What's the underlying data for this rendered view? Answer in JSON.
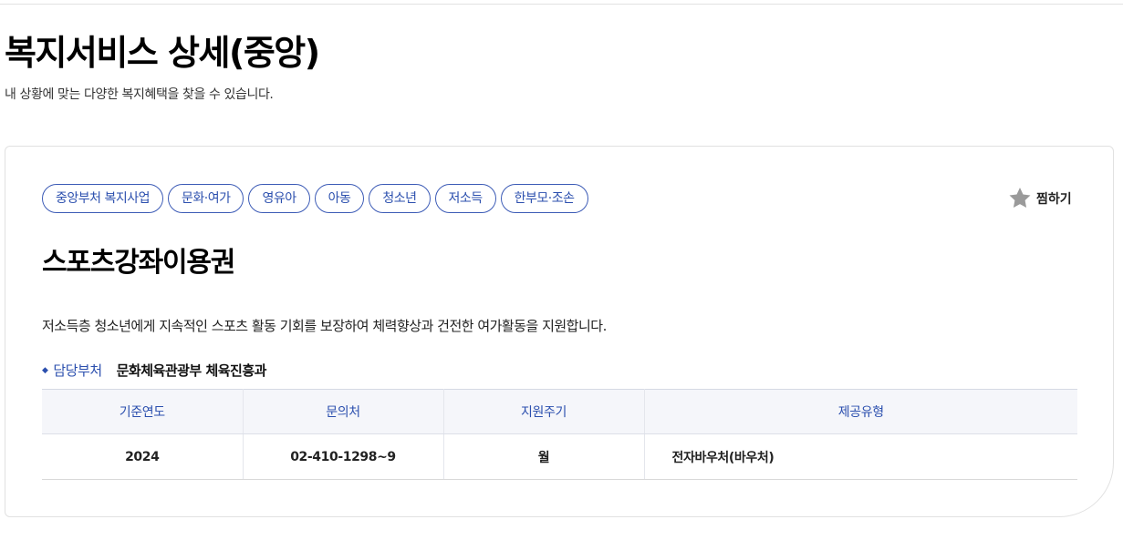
{
  "page": {
    "title": "복지서비스 상세(중앙)",
    "subtitle": "내 상황에 맞는 다양한 복지혜택을 찾을 수 있습니다."
  },
  "card": {
    "tags": [
      "중앙부처 복지사업",
      "문화·여가",
      "영유아",
      "아동",
      "청소년",
      "저소득",
      "한부모·조손"
    ],
    "favorite_label": "찜하기",
    "favorite_icon": "star-icon",
    "service_title": "스포츠강좌이용권",
    "description": "저소득층 청소년에게 지속적인 스포츠 활동 기회를 보장하여 체력향상과 건전한 여가활동을 지원합니다.",
    "department": {
      "label": "담당부처",
      "value": "문화체육관광부 체육진흥과"
    },
    "table": {
      "headers": [
        "기준연도",
        "문의처",
        "지원주기",
        "제공유형"
      ],
      "row": [
        "2024",
        "02-410-1298~9",
        "월",
        "전자바우처(바우처)"
      ]
    }
  },
  "colors": {
    "accent": "#2b4fae",
    "star": "#9a9a9a",
    "header_bg": "#f5f6fa"
  }
}
